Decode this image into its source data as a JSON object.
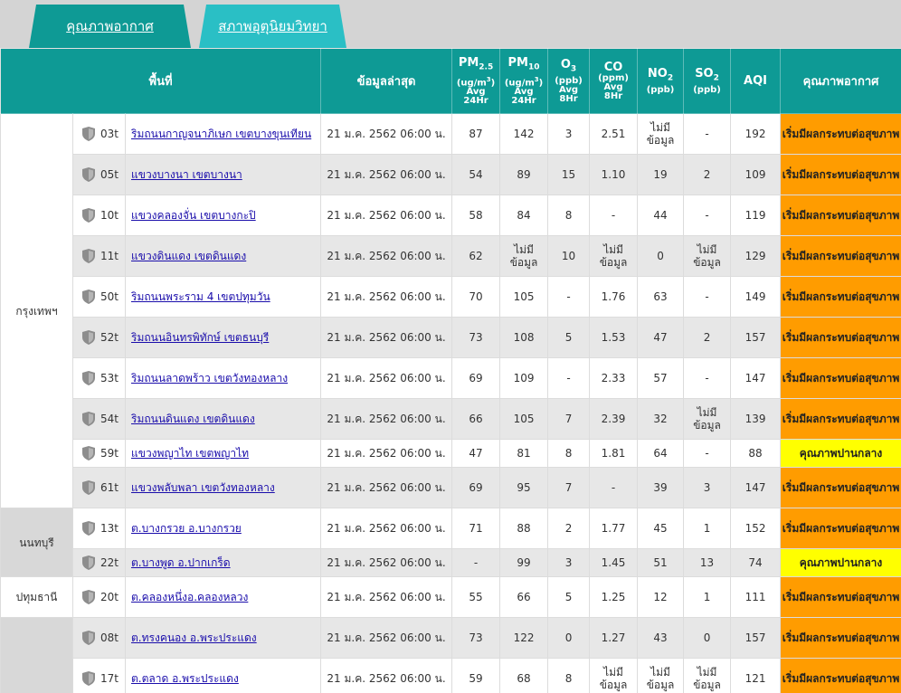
{
  "tabs": [
    {
      "label": "คุณภาพอากาศ",
      "active": true
    },
    {
      "label": "สภาพอุตุนิยมวิทยา",
      "active": false
    }
  ],
  "headers": {
    "area": "พื้นที่",
    "latest": "ข้อมูลล่าสุด",
    "pm25": {
      "name": "PM2.5",
      "unit": "(ug/m3)",
      "avg": "Avg",
      "period": "24Hr"
    },
    "pm10": {
      "name": "PM10",
      "unit": "(ug/m3)",
      "avg": "Avg",
      "period": "24Hr"
    },
    "o3": {
      "name": "O3",
      "unit": "(ppb)",
      "avg": "Avg",
      "period": "8Hr"
    },
    "co": {
      "name": "CO",
      "unit": "(ppm)",
      "avg": "Avg",
      "period": "8Hr"
    },
    "no2": {
      "name": "NO2",
      "unit": "(ppb)"
    },
    "so2": {
      "name": "SO2",
      "unit": "(ppb)"
    },
    "aqi": "AQI",
    "quality": "คุณภาพอากาศ"
  },
  "colors": {
    "header_bg": "#0e9a95",
    "orange": "#ff9c00",
    "yellow": "#ffff00",
    "link": "#1a0dab"
  },
  "provinces": [
    "กรุงเทพฯ",
    "นนทบุรี",
    "ปทุมธานี",
    ""
  ],
  "rows": [
    {
      "id": "03t",
      "loc": "ริมถนนกาญจนาภิเษก เขตบางขุนเทียน",
      "time": "21 ม.ค. 2562 06:00 น.",
      "pm25": "87",
      "pm10": "142",
      "o3": "3",
      "co": "2.51",
      "no2": "ไม่มีข้อมูล",
      "so2": "-",
      "aqi": "192",
      "quality": "เริ่มมีผลกระทบต่อสุขภาพ",
      "level": "orange"
    },
    {
      "id": "05t",
      "loc": "แขวงบางนา เขตบางนา",
      "time": "21 ม.ค. 2562 06:00 น.",
      "pm25": "54",
      "pm10": "89",
      "o3": "15",
      "co": "1.10",
      "no2": "19",
      "so2": "2",
      "aqi": "109",
      "quality": "เริ่มมีผลกระทบต่อสุขภาพ",
      "level": "orange"
    },
    {
      "id": "10t",
      "loc": "แขวงคลองจั่น เขตบางกะปิ",
      "time": "21 ม.ค. 2562 06:00 น.",
      "pm25": "58",
      "pm10": "84",
      "o3": "8",
      "co": "-",
      "no2": "44",
      "so2": "-",
      "aqi": "119",
      "quality": "เริ่มมีผลกระทบต่อสุขภาพ",
      "level": "orange"
    },
    {
      "id": "11t",
      "loc": "แขวงดินแดง เขตดินแดง",
      "time": "21 ม.ค. 2562 06:00 น.",
      "pm25": "62",
      "pm10": "ไม่มีข้อมูล",
      "o3": "10",
      "co": "ไม่มีข้อมูล",
      "no2": "0",
      "so2": "ไม่มีข้อมูล",
      "aqi": "129",
      "quality": "เริ่มมีผลกระทบต่อสุขภาพ",
      "level": "orange"
    },
    {
      "id": "50t",
      "loc": "ริมถนนพระราม 4 เขตปทุมวัน",
      "time": "21 ม.ค. 2562 06:00 น.",
      "pm25": "70",
      "pm10": "105",
      "o3": "-",
      "co": "1.76",
      "no2": "63",
      "so2": "-",
      "aqi": "149",
      "quality": "เริ่มมีผลกระทบต่อสุขภาพ",
      "level": "orange"
    },
    {
      "id": "52t",
      "loc": "ริมถนนอินทรพิทักษ์ เขตธนบุรี",
      "time": "21 ม.ค. 2562 06:00 น.",
      "pm25": "73",
      "pm10": "108",
      "o3": "5",
      "co": "1.53",
      "no2": "47",
      "so2": "2",
      "aqi": "157",
      "quality": "เริ่มมีผลกระทบต่อสุขภาพ",
      "level": "orange"
    },
    {
      "id": "53t",
      "loc": "ริมถนนลาดพร้าว เขตวังทองหลาง",
      "time": "21 ม.ค. 2562 06:00 น.",
      "pm25": "69",
      "pm10": "109",
      "o3": "-",
      "co": "2.33",
      "no2": "57",
      "so2": "-",
      "aqi": "147",
      "quality": "เริ่มมีผลกระทบต่อสุขภาพ",
      "level": "orange"
    },
    {
      "id": "54t",
      "loc": "ริมถนนดินแดง เขตดินแดง",
      "time": "21 ม.ค. 2562 06:00 น.",
      "pm25": "66",
      "pm10": "105",
      "o3": "7",
      "co": "2.39",
      "no2": "32",
      "so2": "ไม่มีข้อมูล",
      "aqi": "139",
      "quality": "เริ่มมีผลกระทบต่อสุขภาพ",
      "level": "orange"
    },
    {
      "id": "59t",
      "loc": "แขวงพญาไท เขตพญาไท",
      "time": "21 ม.ค. 2562 06:00 น.",
      "pm25": "47",
      "pm10": "81",
      "o3": "8",
      "co": "1.81",
      "no2": "64",
      "so2": "-",
      "aqi": "88",
      "quality": "คุณภาพปานกลาง",
      "level": "yellow"
    },
    {
      "id": "61t",
      "loc": "แขวงพลับพลา เขตวังทองหลาง",
      "time": "21 ม.ค. 2562 06:00 น.",
      "pm25": "69",
      "pm10": "95",
      "o3": "7",
      "co": "-",
      "no2": "39",
      "so2": "3",
      "aqi": "147",
      "quality": "เริ่มมีผลกระทบต่อสุขภาพ",
      "level": "orange"
    },
    {
      "id": "13t",
      "loc": "ต.บางกรวย อ.บางกรวย",
      "time": "21 ม.ค. 2562 06:00 น.",
      "pm25": "71",
      "pm10": "88",
      "o3": "2",
      "co": "1.77",
      "no2": "45",
      "so2": "1",
      "aqi": "152",
      "quality": "เริ่มมีผลกระทบต่อสุขภาพ",
      "level": "orange"
    },
    {
      "id": "22t",
      "loc": "ต.บางพูด อ.ปากเกร็ด",
      "time": "21 ม.ค. 2562 06:00 น.",
      "pm25": "-",
      "pm10": "99",
      "o3": "3",
      "co": "1.45",
      "no2": "51",
      "so2": "13",
      "aqi": "74",
      "quality": "คุณภาพปานกลาง",
      "level": "yellow"
    },
    {
      "id": "20t",
      "loc": "ต.คลองหนึ่งอ.คลองหลวง",
      "time": "21 ม.ค. 2562 06:00 น.",
      "pm25": "55",
      "pm10": "66",
      "o3": "5",
      "co": "1.25",
      "no2": "12",
      "so2": "1",
      "aqi": "111",
      "quality": "เริ่มมีผลกระทบต่อสุขภาพ",
      "level": "orange"
    },
    {
      "id": "08t",
      "loc": "ต.ทรงคนอง อ.พระประแดง",
      "time": "21 ม.ค. 2562 06:00 น.",
      "pm25": "73",
      "pm10": "122",
      "o3": "0",
      "co": "1.27",
      "no2": "43",
      "so2": "0",
      "aqi": "157",
      "quality": "เริ่มมีผลกระทบต่อสุขภาพ",
      "level": "orange"
    },
    {
      "id": "17t",
      "loc": "ต.ตลาด อ.พระประแดง",
      "time": "21 ม.ค. 2562 06:00 น.",
      "pm25": "59",
      "pm10": "68",
      "o3": "8",
      "co": "ไม่มีข้อมูล",
      "no2": "ไม่มีข้อมูล",
      "so2": "ไม่มีข้อมูล",
      "aqi": "121",
      "quality": "เริ่มมีผลกระทบต่อสุขภาพ",
      "level": "orange"
    }
  ]
}
